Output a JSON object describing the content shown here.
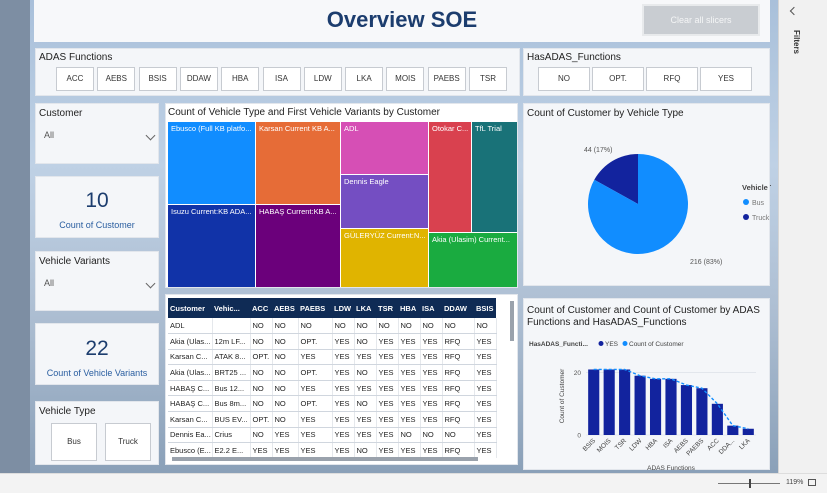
{
  "report": {
    "title": "Overview SOE",
    "clear_label": "Clear all slicers"
  },
  "adas": {
    "label": "ADAS Functions",
    "options": [
      "ACC",
      "AEBS",
      "BSIS",
      "DDAW",
      "HBA",
      "ISA",
      "LDW",
      "LKA",
      "MOIS",
      "PAEBS",
      "TSR"
    ]
  },
  "has_adas": {
    "label": "HasADAS_Functions",
    "options": [
      "NO",
      "OPT.",
      "RFQ",
      "YES"
    ]
  },
  "customer": {
    "label": "Customer",
    "value": "All"
  },
  "kpi_customer": {
    "value": "10",
    "label": "Count of Customer"
  },
  "variants": {
    "label": "Vehicle Variants",
    "value": "All"
  },
  "kpi_variants": {
    "value": "22",
    "label": "Count of Vehicle Variants"
  },
  "vehicle_type": {
    "label": "Vehicle Type",
    "options": [
      "Bus",
      "Truck"
    ]
  },
  "treemap": {
    "title": "Count of Vehicle Type and First Vehicle Variants by Customer",
    "tiles": [
      {
        "label": "Ebusco (Full KB platfo...",
        "color": "#118dff"
      },
      {
        "label": "Karsan Current KB A...",
        "color": "#e66c37"
      },
      {
        "label": "ADL",
        "color": "#d64fb5"
      },
      {
        "label": "Otokar C...",
        "color": "#d9414f"
      },
      {
        "label": "TfL Trial",
        "color": "#197278"
      },
      {
        "label": "Dennis Eagle",
        "color": "#744ec2"
      },
      {
        "label": "Isuzu Current:KB ADA...",
        "color": "#1133a8"
      },
      {
        "label": "HABAŞ Current:KB A...",
        "color": "#6b007b"
      },
      {
        "label": "GÜLERYÜZ Current:N...",
        "color": "#e0b400"
      },
      {
        "label": "Akia (Ulasim) Current...",
        "color": "#1aab40"
      }
    ]
  },
  "table": {
    "headers": [
      "Customer",
      "Vehic...",
      "ACC",
      "AEBS",
      "PAEBS",
      "LDW",
      "LKA",
      "TSR",
      "HBA",
      "ISA",
      "DDAW",
      "BSIS"
    ],
    "rows": [
      [
        "ADL",
        "",
        "NO",
        "NO",
        "NO",
        "NO",
        "NO",
        "NO",
        "NO",
        "NO",
        "NO",
        "NO"
      ],
      [
        "Akia (Ulas...",
        "12m LF...",
        "NO",
        "NO",
        "OPT.",
        "YES",
        "NO",
        "YES",
        "YES",
        "YES",
        "RFQ",
        "YES"
      ],
      [
        "Karsan C...",
        "ATAK 8...",
        "OPT.",
        "NO",
        "YES",
        "YES",
        "YES",
        "YES",
        "YES",
        "YES",
        "RFQ",
        "YES"
      ],
      [
        "Akia (Ulas...",
        "BRT25 ...",
        "NO",
        "NO",
        "OPT.",
        "YES",
        "NO",
        "YES",
        "YES",
        "YES",
        "RFQ",
        "YES"
      ],
      [
        "HABAŞ C...",
        "Bus 12...",
        "NO",
        "NO",
        "YES",
        "YES",
        "YES",
        "YES",
        "YES",
        "YES",
        "RFQ",
        "YES"
      ],
      [
        "HABAŞ C...",
        "Bus 8m...",
        "NO",
        "NO",
        "OPT.",
        "YES",
        "NO",
        "YES",
        "YES",
        "YES",
        "RFQ",
        "YES"
      ],
      [
        "Karsan C...",
        "BUS EV...",
        "OPT.",
        "NO",
        "YES",
        "YES",
        "YES",
        "YES",
        "YES",
        "YES",
        "RFQ",
        "YES"
      ],
      [
        "Dennis Ea...",
        "Crius",
        "NO",
        "YES",
        "YES",
        "YES",
        "YES",
        "YES",
        "NO",
        "NO",
        "NO",
        "YES"
      ],
      [
        "Ebusco (E...",
        "E2.2 E...",
        "YES",
        "YES",
        "YES",
        "YES",
        "NO",
        "YES",
        "YES",
        "YES",
        "RFQ",
        "YES"
      ]
    ]
  },
  "pie": {
    "title": "Count of Customer by Vehicle Type",
    "legend_title": "Vehicle Type",
    "colors": {
      "Bus": "#118dff",
      "Truck": "#12239e"
    }
  },
  "bar": {
    "title": "Count of Customer and Count of Customer by ADAS Functions and HasADAS_Functions",
    "legend_title": "HasADAS_Functi...",
    "legend_items": [
      "YES",
      "Count of Customer"
    ],
    "bar_color": "#12239e",
    "line_color": "#118dff"
  },
  "chart_data": [
    {
      "type": "pie",
      "title": "Count of Customer by Vehicle Type",
      "categories": [
        "Bus",
        "Truck"
      ],
      "values": [
        216,
        44
      ],
      "labels": [
        "216 (83%)",
        "44 (17%)"
      ],
      "legend": "right"
    },
    {
      "type": "bar",
      "title": "Count of Customer and Count of Customer by ADAS Functions and HasADAS_Functions",
      "xlabel": "ADAS Functions",
      "ylabel": "Count of Customer",
      "categories": [
        "BSIS",
        "MOIS",
        "TSR",
        "LDW",
        "HBA",
        "ISA",
        "AEBS",
        "PAEBS",
        "ACC",
        "DDA...",
        "LKA"
      ],
      "series": [
        {
          "name": "YES",
          "values": [
            21,
            21,
            21,
            19,
            18,
            18,
            16,
            15,
            10,
            3,
            2
          ]
        },
        {
          "name": "Count of Customer",
          "values": [
            21,
            21,
            21,
            19,
            18,
            18,
            16,
            15,
            10,
            3,
            2
          ]
        }
      ],
      "ylim": [
        0,
        25
      ],
      "yticks": [
        0,
        20
      ],
      "legend": "top-left"
    }
  ],
  "status": {
    "zoom": "119%"
  }
}
